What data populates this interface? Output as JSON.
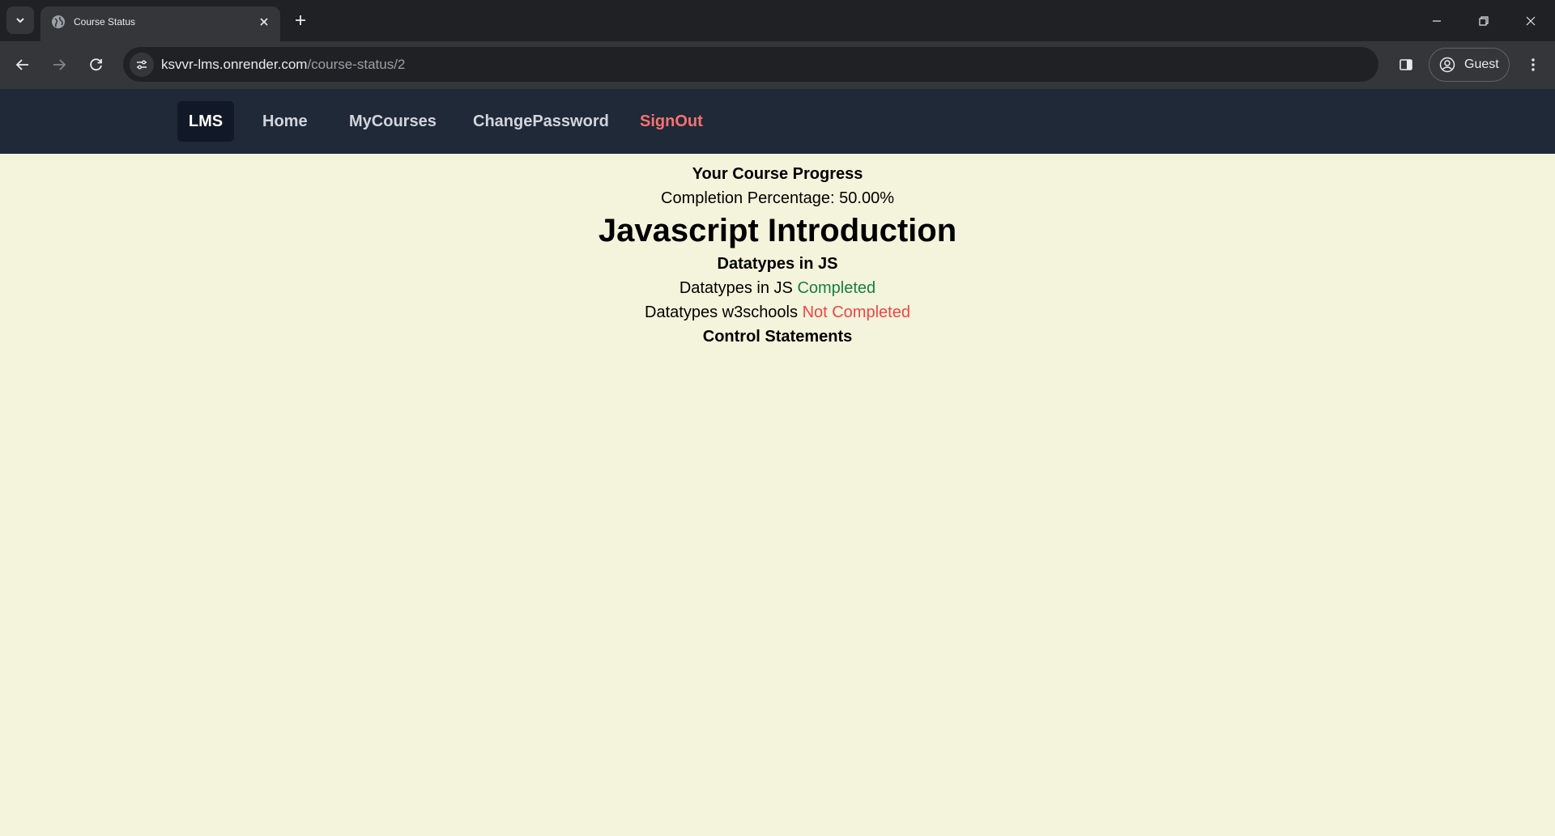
{
  "browser": {
    "tab_title": "Course Status",
    "url_host": "ksvvr-lms.onrender.com",
    "url_path": "/course-status/2",
    "profile_label": "Guest"
  },
  "navbar": {
    "brand": "LMS",
    "links": [
      "Home",
      "MyCourses",
      "ChangePassword"
    ],
    "signout": "SignOut"
  },
  "progress": {
    "heading": "Your Course Progress",
    "completion_text": "Completion Percentage: 50.00%",
    "completion_value": 50.0
  },
  "course": {
    "title": "Javascript Introduction",
    "chapters": [
      {
        "title": "Datatypes in JS",
        "pages": [
          {
            "name": "Datatypes in JS",
            "status": "Completed"
          },
          {
            "name": "Datatypes w3schools",
            "status": "Not Completed"
          }
        ]
      },
      {
        "title": "Control Statements",
        "pages": []
      }
    ]
  },
  "colors": {
    "page_background": "#f4f4dc",
    "navbar_background": "#1f2937",
    "completed": "#15803d",
    "not_completed": "#ef4444",
    "signout": "#f87171"
  },
  "icons": [
    "tab-list-icon",
    "globe-icon",
    "close-icon",
    "plus-icon",
    "minimize-icon",
    "restore-icon",
    "window-close-icon",
    "back-arrow-icon",
    "forward-arrow-icon",
    "reload-icon",
    "site-info-icon",
    "side-panel-icon",
    "profile-icon",
    "kebab-menu-icon"
  ]
}
